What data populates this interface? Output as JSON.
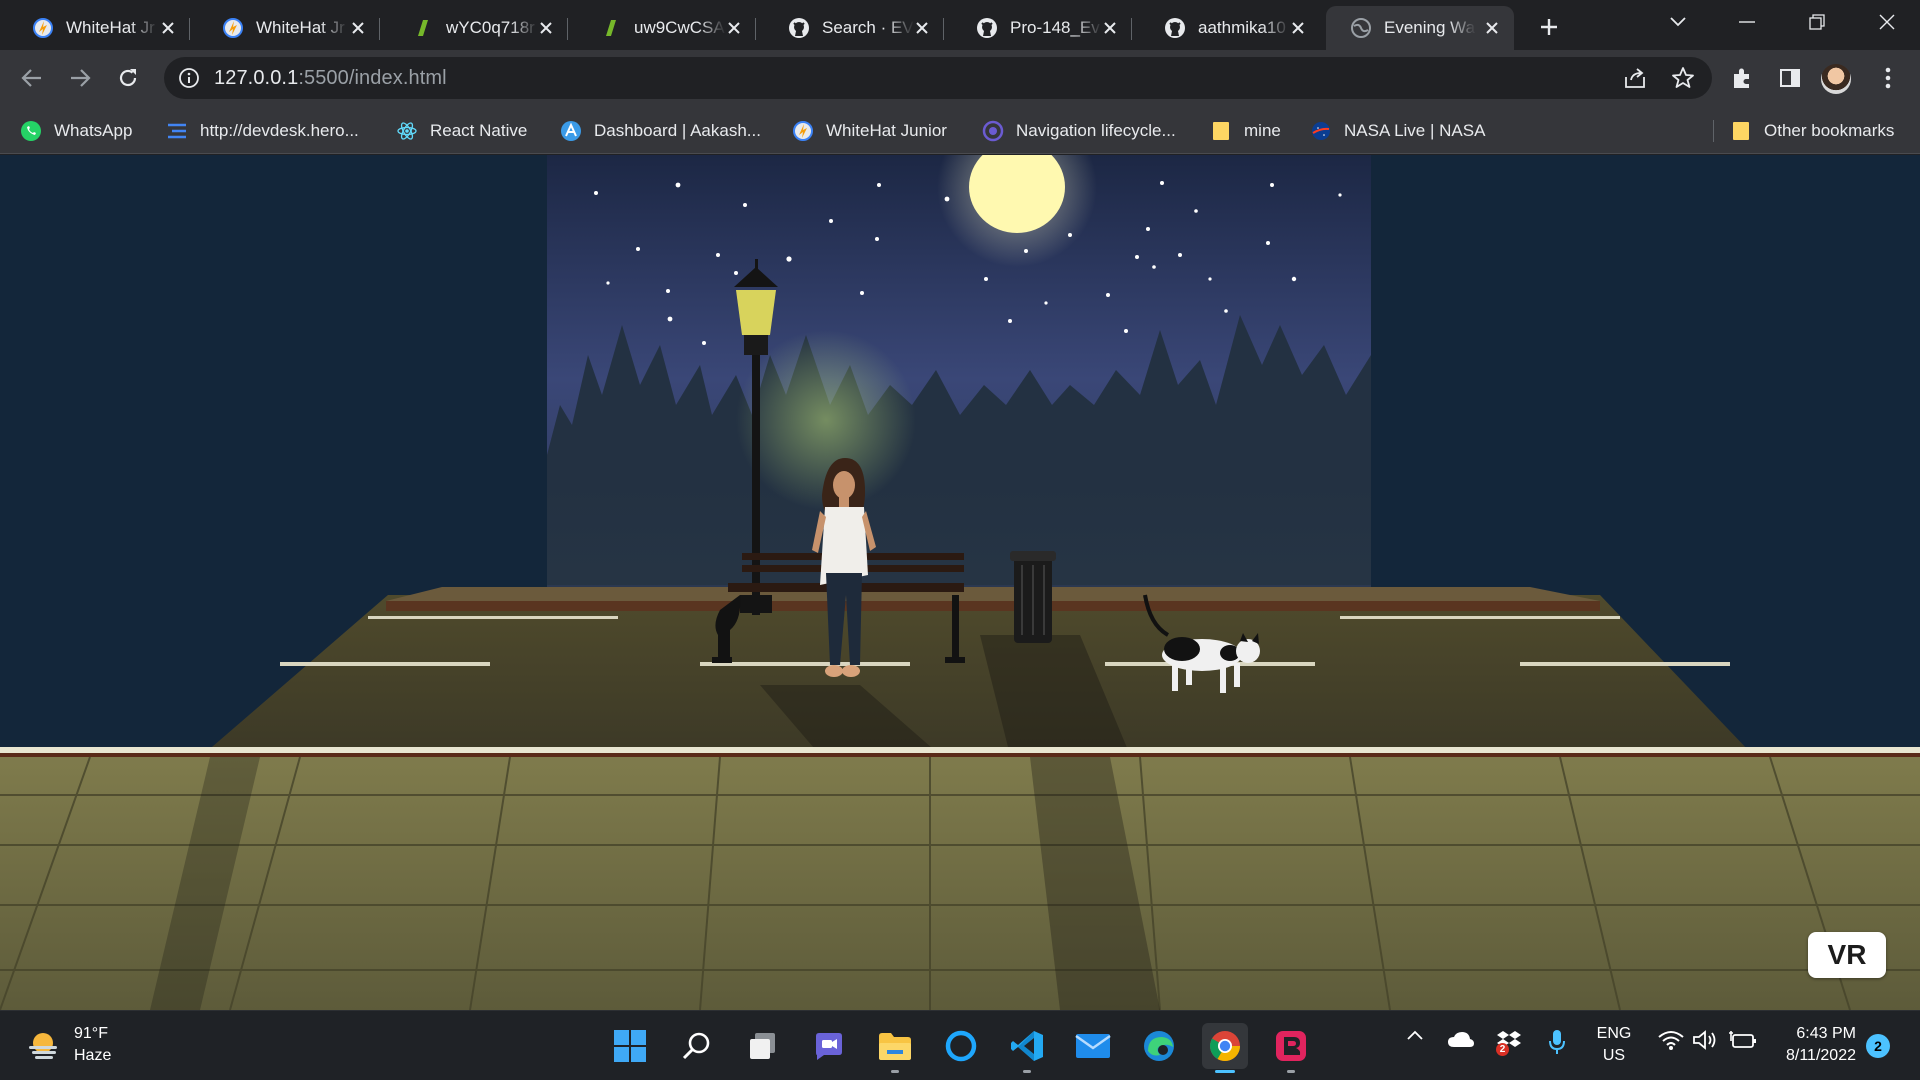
{
  "browser": {
    "tabs": [
      {
        "title": "WhiteHat Jr",
        "icon": "whitehat-icon",
        "active": false
      },
      {
        "title": "WhiteHat Jr",
        "icon": "whitehat-icon",
        "active": false
      },
      {
        "title": "wYC0q718r",
        "icon": "codepen-icon",
        "active": false
      },
      {
        "title": "uw9CwCSA",
        "icon": "codepen-icon",
        "active": false
      },
      {
        "title": "Search · EVI",
        "icon": "github-icon",
        "active": false
      },
      {
        "title": "Pro-148_Ev",
        "icon": "github-icon",
        "active": false
      },
      {
        "title": "aathmika10",
        "icon": "github-icon",
        "active": false
      },
      {
        "title": "Evening Wa",
        "icon": "globe-icon",
        "active": true
      }
    ],
    "address": {
      "host": "127.0.0.1",
      "path": ":5500/index.html"
    },
    "bookmarks": [
      {
        "label": "WhatsApp",
        "icon": "whatsapp-icon"
      },
      {
        "label": "http://devdesk.hero...",
        "icon": "list-icon"
      },
      {
        "label": "React Native",
        "icon": "react-icon"
      },
      {
        "label": "Dashboard | Aakash...",
        "icon": "dashboard-icon"
      },
      {
        "label": "WhiteHat Junior",
        "icon": "whitehat-icon"
      },
      {
        "label": "Navigation lifecycle...",
        "icon": "navigation-icon"
      },
      {
        "label": "mine",
        "icon": "folder-icon"
      },
      {
        "label": "NASA Live | NASA",
        "icon": "nasa-icon"
      }
    ],
    "other_bookmarks": "Other bookmarks"
  },
  "scene": {
    "vr_button": "VR"
  },
  "taskbar": {
    "weather_temp": "91°F",
    "weather_desc": "Haze",
    "lang_line1": "ENG",
    "lang_line2": "US",
    "time": "6:43 PM",
    "date": "8/11/2022",
    "notification_count": "2",
    "dropbox_badge": "2"
  },
  "colors": {
    "chrome_dark": "#202124",
    "chrome_toolbar": "#35363a",
    "scene_bg": "#13263a",
    "accent": "#4cc2ff"
  }
}
